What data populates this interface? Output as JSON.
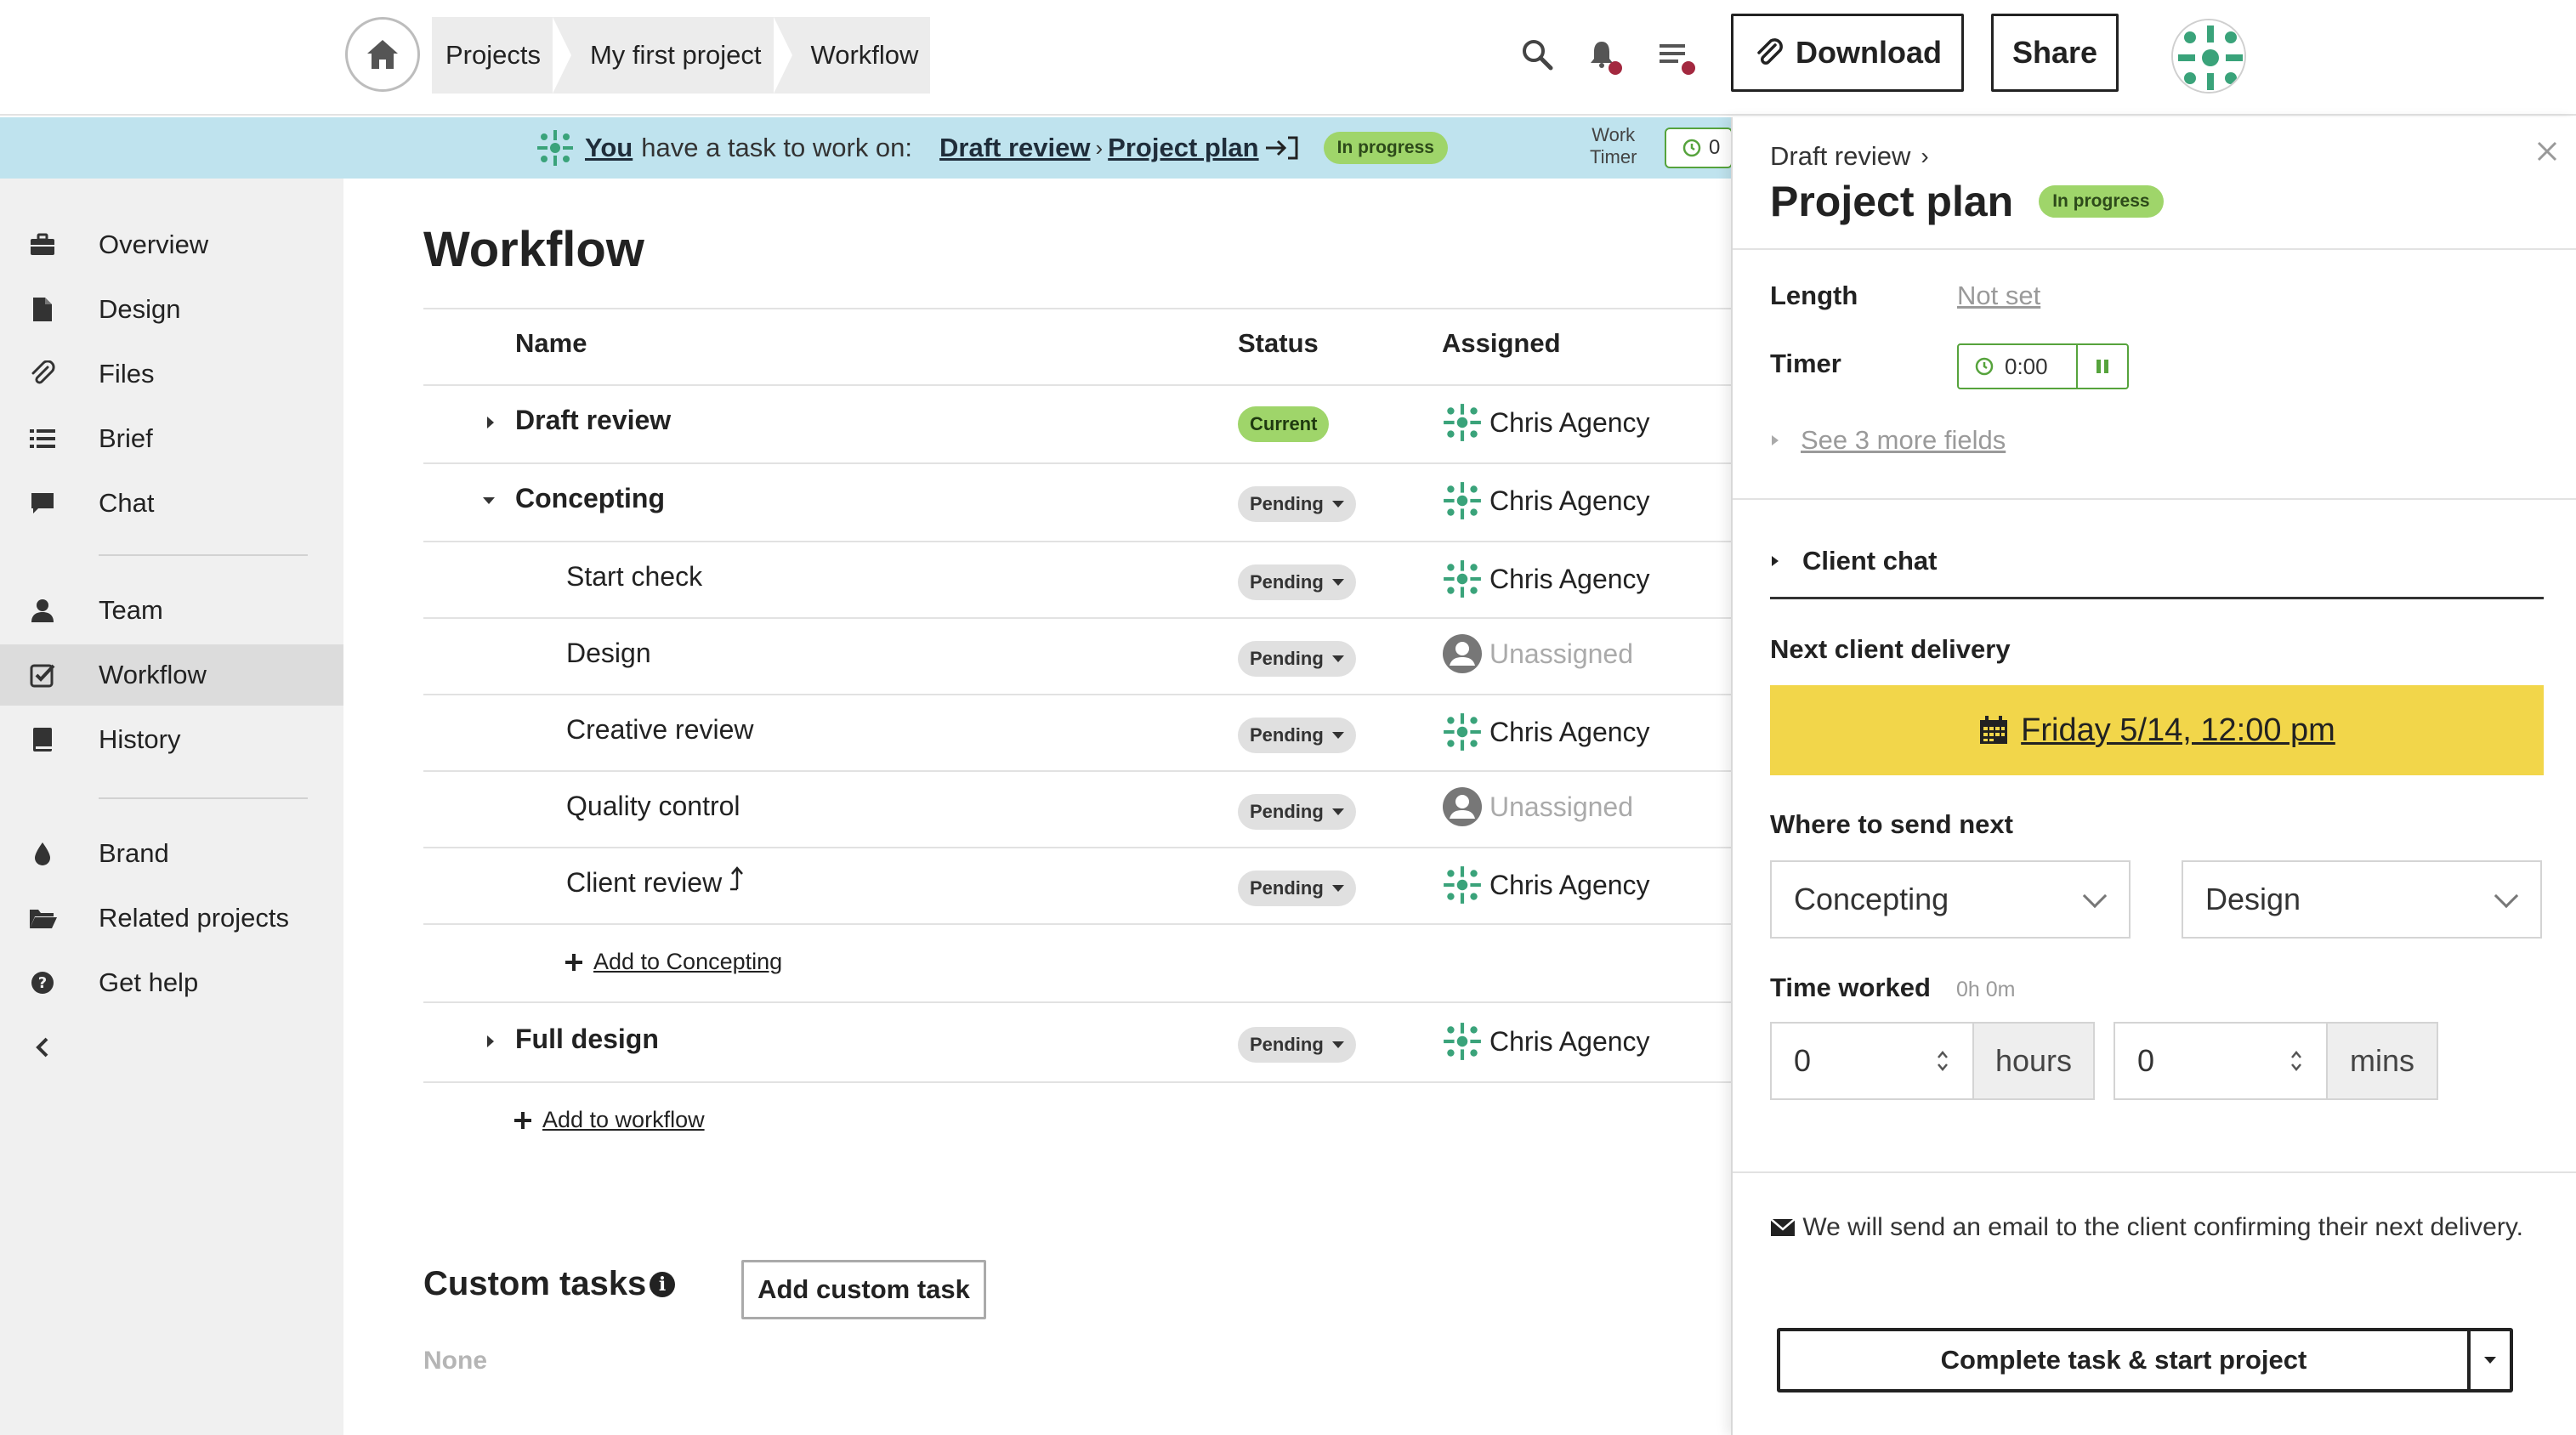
{
  "topbar": {
    "breadcrumbs": [
      "Projects",
      "My first project",
      "Workflow"
    ],
    "download_label": "Download",
    "share_label": "Share"
  },
  "banner": {
    "you": "You",
    "text": "have a task to work on:",
    "task_parent": "Draft review",
    "task_name": "Project plan",
    "status": "In progress",
    "work_timer_label_1": "Work",
    "work_timer_label_2": "Timer",
    "work_timer_value": "0"
  },
  "sidebar": {
    "items": [
      {
        "label": "Overview",
        "icon": "briefcase-icon"
      },
      {
        "label": "Design",
        "icon": "file-icon"
      },
      {
        "label": "Files",
        "icon": "paperclip-icon"
      },
      {
        "label": "Brief",
        "icon": "list-icon"
      },
      {
        "label": "Chat",
        "icon": "chat-icon"
      },
      {
        "label": "Team",
        "icon": "user-icon"
      },
      {
        "label": "Workflow",
        "icon": "checkbox-icon",
        "active": true
      },
      {
        "label": "History",
        "icon": "book-icon"
      },
      {
        "label": "Brand",
        "icon": "drop-icon"
      },
      {
        "label": "Related projects",
        "icon": "folder-icon"
      },
      {
        "label": "Get help",
        "icon": "help-icon"
      }
    ],
    "collapse_icon": "chevron-left-icon"
  },
  "main": {
    "title": "Workflow",
    "columns": {
      "name": "Name",
      "status": "Status",
      "assigned": "Assigned"
    },
    "rows": [
      {
        "name": "Draft review",
        "status": "Current",
        "assigned": "Chris Agency"
      },
      {
        "name": "Concepting",
        "status": "Pending",
        "assigned": "Chris Agency"
      },
      {
        "name": "Start check",
        "status": "Pending",
        "assigned": "Chris Agency"
      },
      {
        "name": "Design",
        "status": "Pending",
        "assigned": "Unassigned"
      },
      {
        "name": "Creative review",
        "status": "Pending",
        "assigned": "Chris Agency"
      },
      {
        "name": "Quality control",
        "status": "Pending",
        "assigned": "Unassigned"
      },
      {
        "name": "Client review",
        "status": "Pending",
        "assigned": "Chris Agency"
      },
      {
        "name": "Full design",
        "status": "Pending",
        "assigned": "Chris Agency"
      }
    ],
    "add_to_concepting": "Add to Concepting",
    "add_to_workflow": "Add to workflow",
    "custom_tasks_title": "Custom tasks",
    "add_custom_task": "Add custom task",
    "custom_tasks_none": "None"
  },
  "panel": {
    "parent": "Draft review",
    "title": "Project plan",
    "status": "In progress",
    "length_label": "Length",
    "length_value": "Not set",
    "timer_label": "Timer",
    "timer_value": "0:00",
    "more_fields": "See 3 more fields",
    "client_chat": "Client chat",
    "next_delivery_label": "Next client delivery",
    "next_delivery_value": "Friday 5/14, 12:00 pm",
    "where_next_label": "Where to send next",
    "where_next_stage": "Concepting",
    "where_next_task": "Design",
    "time_worked_label": "Time worked",
    "time_worked_total": "0h 0m",
    "hours_value": "0",
    "hours_unit": "hours",
    "mins_value": "0",
    "mins_unit": "mins",
    "email_note": "We will send an email to the client confirming their next delivery.",
    "complete_label": "Complete task & start project"
  },
  "colors": {
    "banner_bg": "#bfe3ee",
    "pill_green": "#9fd56a",
    "delivery_yellow": "#f2d64a",
    "notification_dot": "#a3283f",
    "avatar_green": "#3aa37a"
  }
}
